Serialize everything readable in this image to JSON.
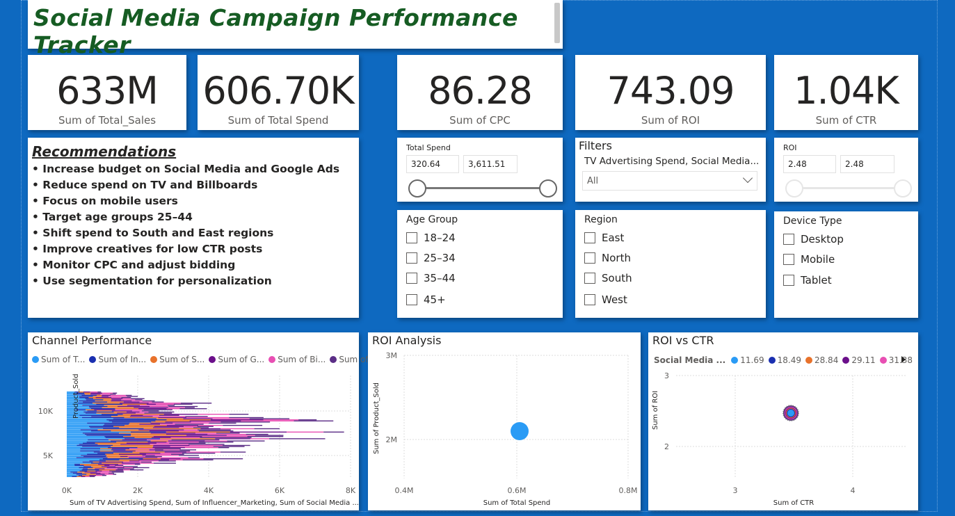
{
  "title": "Social Media Campaign Performance Tracker",
  "kpis": [
    {
      "value": "633M",
      "label": "Sum of Total_Sales"
    },
    {
      "value": "606.70K",
      "label": "Sum of Total Spend"
    },
    {
      "value": "86.28",
      "label": "Sum of CPC"
    },
    {
      "value": "743.09",
      "label": "Sum of ROI"
    },
    {
      "value": "1.04K",
      "label": "Sum of CTR"
    }
  ],
  "recommendations": {
    "heading": "Recommendations",
    "items": [
      "• Increase budget on Social Media and Google Ads",
      "• Reduce spend on TV and Billboards",
      "• Focus on mobile users",
      "• Target age groups 25–44",
      "• Shift spend to South and East regions",
      "• Improve creatives for low CTR posts",
      "• Monitor CPC and adjust bidding",
      "• Use segmentation for personalization"
    ]
  },
  "total_spend_slicer": {
    "title": "Total Spend",
    "min": "320.64",
    "max": "3,611.51"
  },
  "filters": {
    "title": "Filters",
    "field": "TV Advertising Spend, Social Media...",
    "value": "All"
  },
  "roi_slicer": {
    "title": "ROI",
    "min": "2.48",
    "max": "2.48"
  },
  "age_group": {
    "title": "Age Group",
    "options": [
      "18–24",
      "25–34",
      "35–44",
      "45+"
    ]
  },
  "region": {
    "title": "Region",
    "options": [
      "East",
      "North",
      "South",
      "West"
    ]
  },
  "device_type": {
    "title": "Device Type",
    "options": [
      "Desktop",
      "Mobile",
      "Tablet"
    ]
  },
  "colors": {
    "background": "#0e69c0",
    "title_green": "#165c23",
    "series": [
      "#2a9bf5",
      "#1a2fb0",
      "#e8722b",
      "#6b0f8a",
      "#e84fb3",
      "#5b2d86"
    ]
  },
  "chart_data": [
    {
      "type": "bar",
      "title": "Channel Performance",
      "legend": [
        "Sum of T...",
        "Sum of In...",
        "Sum of  S...",
        "Sum of G...",
        "Sum of Bi...",
        "Sum of A..."
      ],
      "xlabel": "Sum of TV Advertising Spend, Sum of Influencer_Marketing, Sum of Social Media ...",
      "ylabel": "Product_Sold",
      "xticks": [
        "0K",
        "2K",
        "4K",
        "6K",
        "8K"
      ],
      "yticks": [
        "5K",
        "10K"
      ],
      "xlim": [
        0,
        8000
      ]
    },
    {
      "type": "scatter",
      "title": "ROI Analysis",
      "xlabel": "Sum of Total Spend",
      "ylabel": "Sum of Product_Sold",
      "xticks": [
        "0.4M",
        "0.6M",
        "0.8M"
      ],
      "yticks": [
        "2M",
        "3M"
      ],
      "points": [
        {
          "x": 606700,
          "y": 2100000
        }
      ]
    },
    {
      "type": "scatter",
      "title": "ROI vs CTR",
      "legend_title": "Social Media ...",
      "legend": [
        "11.69",
        "18.49",
        "28.84",
        "29.11",
        "31.38"
      ],
      "xlabel": "Sum of CTR",
      "ylabel": "Sum of ROI",
      "xticks": [
        "3",
        "4"
      ],
      "yticks": [
        "2",
        "3"
      ],
      "points": [
        {
          "x": 3.48,
          "y": 2.48
        }
      ]
    }
  ]
}
